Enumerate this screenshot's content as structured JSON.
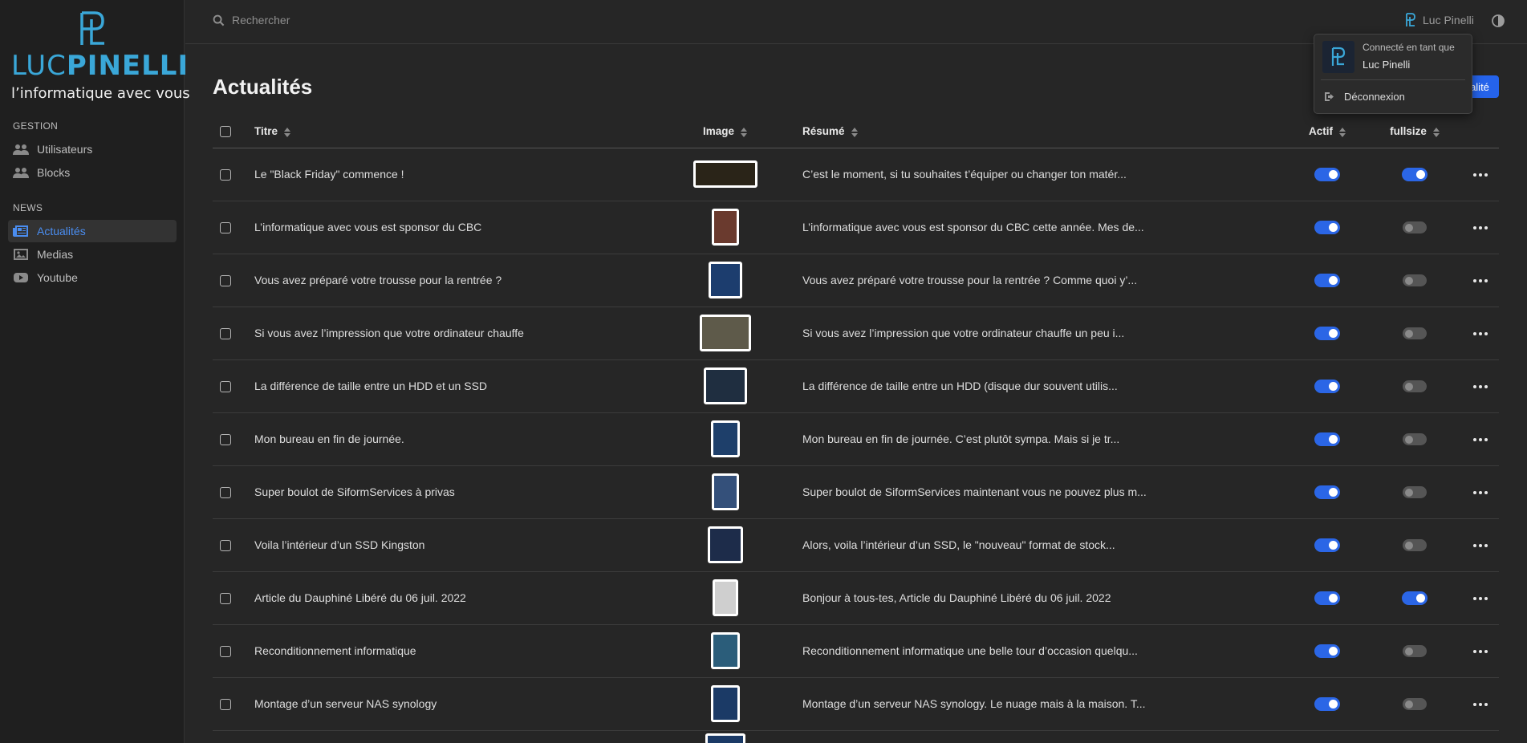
{
  "brand": {
    "name_light": "LUC",
    "name_bold": "PINELLI",
    "tagline": "l’informatique avec vous"
  },
  "sidebar": {
    "sections": [
      {
        "title": "GESTION",
        "items": [
          {
            "label": "Utilisateurs",
            "icon": "users-icon",
            "active": false
          },
          {
            "label": "Blocks",
            "icon": "users-icon",
            "active": false
          }
        ]
      },
      {
        "title": "NEWS",
        "items": [
          {
            "label": "Actualités",
            "icon": "newspaper-icon",
            "active": true
          },
          {
            "label": "Medias",
            "icon": "image-icon",
            "active": false
          },
          {
            "label": "Youtube",
            "icon": "youtube-icon",
            "active": false
          }
        ]
      }
    ]
  },
  "topbar": {
    "search_placeholder": "Rechercher",
    "user_name": "Luc Pinelli"
  },
  "dropdown": {
    "connected_label": "Connecté en tant que",
    "user_name": "Luc Pinelli",
    "logout_label": "Déconnexion"
  },
  "page": {
    "title": "Actualités",
    "add_button_label": "alité"
  },
  "table": {
    "headers": {
      "title": "Titre",
      "image": "Image",
      "summary": "Résumé",
      "active": "Actif",
      "fullsize": "fullsize"
    },
    "rows": [
      {
        "title": "Le \"Black Friday\" commence !",
        "summary": "C’est le moment, si tu souhaites t’équiper ou changer ton matér...",
        "active": true,
        "fullsize": true,
        "thumb_color": "#2a2418",
        "thumb_w": 80,
        "thumb_h": 34
      },
      {
        "title": "L’informatique avec vous est sponsor du CBC",
        "summary": "L’informatique avec vous est sponsor du CBC cette année. Mes de...",
        "active": true,
        "fullsize": false,
        "thumb_color": "#6a3a2e",
        "thumb_w": 34,
        "thumb_h": 46
      },
      {
        "title": "Vous avez préparé votre trousse pour la rentrée ?",
        "summary": "Vous avez préparé votre trousse pour la rentrée ? Comme quoi y’...",
        "active": true,
        "fullsize": false,
        "thumb_color": "#1c3d6e",
        "thumb_w": 42,
        "thumb_h": 46
      },
      {
        "title": "Si vous avez l’impression que votre ordinateur chauffe",
        "summary": "Si vous avez l’impression que votre ordinateur chauffe un peu i...",
        "active": true,
        "fullsize": false,
        "thumb_color": "#5e5a4a",
        "thumb_w": 64,
        "thumb_h": 46
      },
      {
        "title": "La différence de taille entre un HDD et un SSD",
        "summary": "La différence de taille entre un HDD (disque dur souvent utilis...",
        "active": true,
        "fullsize": false,
        "thumb_color": "#1f2e40",
        "thumb_w": 54,
        "thumb_h": 46
      },
      {
        "title": "Mon bureau en fin de journée.",
        "summary": "Mon bureau en fin de journée. C’est plutôt sympa. Mais si je tr...",
        "active": true,
        "fullsize": false,
        "thumb_color": "#1e3f6a",
        "thumb_w": 36,
        "thumb_h": 46
      },
      {
        "title": "Super boulot de SiformServices à privas",
        "summary": "Super boulot de SiformServices maintenant vous ne pouvez plus m...",
        "active": true,
        "fullsize": false,
        "thumb_color": "#34507a",
        "thumb_w": 34,
        "thumb_h": 46
      },
      {
        "title": "Voila l’intérieur d’un SSD Kingston",
        "summary": "Alors, voila l’intérieur d’un SSD, le \"nouveau\" format de stock...",
        "active": true,
        "fullsize": false,
        "thumb_color": "#1d2c4a",
        "thumb_w": 44,
        "thumb_h": 46
      },
      {
        "title": "Article du Dauphiné Libéré du 06 juil. 2022",
        "summary": "Bonjour à tous-tes, Article du Dauphiné Libéré du 06 juil. 2022",
        "active": true,
        "fullsize": true,
        "thumb_color": "#cfcfcf",
        "thumb_w": 32,
        "thumb_h": 46
      },
      {
        "title": "Reconditionnement informatique",
        "summary": "Reconditionnement informatique une belle tour d’occasion quelqu...",
        "active": true,
        "fullsize": false,
        "thumb_color": "#2b5d7a",
        "thumb_w": 36,
        "thumb_h": 46
      },
      {
        "title": "Montage d’un serveur NAS synology",
        "summary": "Montage d’un serveur NAS synology. Le nuage mais à la maison. T...",
        "active": true,
        "fullsize": false,
        "thumb_color": "#1b3a66",
        "thumb_w": 36,
        "thumb_h": 46
      }
    ]
  }
}
